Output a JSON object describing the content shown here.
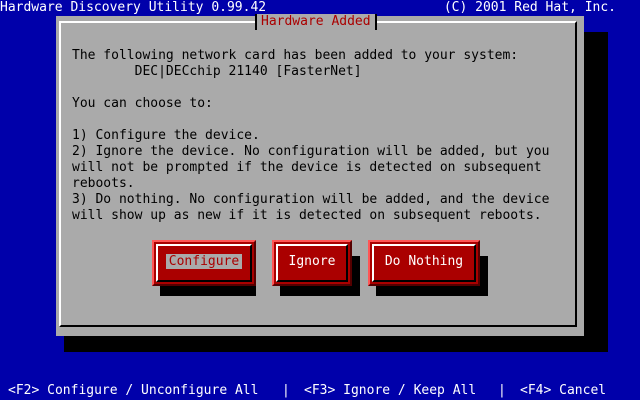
{
  "header": {
    "app_title": "Hardware Discovery Utility 0.99.42",
    "copyright": "(C) 2001 Red Hat, Inc."
  },
  "dialog": {
    "title": "Hardware Added",
    "lines": [
      "The following network card has been added to your system:",
      "        DEC|DECchip 21140 [FasterNet]",
      "",
      "You can choose to:",
      "",
      "1) Configure the device.",
      "2) Ignore the device. No configuration will be added, but you",
      "will not be prompted if the device is detected on subsequent",
      "reboots.",
      "3) Do nothing. No configuration will be added, and the device",
      "will show up as new if it is detected on subsequent reboots."
    ],
    "buttons": {
      "configure": "Configure",
      "ignore": "Ignore",
      "do_nothing": "Do Nothing"
    }
  },
  "footer": {
    "hints": {
      "f2": "<F2> Configure / Unconfigure All",
      "f3": "<F3> Ignore / Keep All",
      "f4": "<F4> Cancel"
    },
    "separator": "|"
  },
  "colors": {
    "screen_background": "#0000aa",
    "dialog_background": "#aaaaaa",
    "button_background": "#aa0000",
    "title_text": "#aa0000"
  }
}
